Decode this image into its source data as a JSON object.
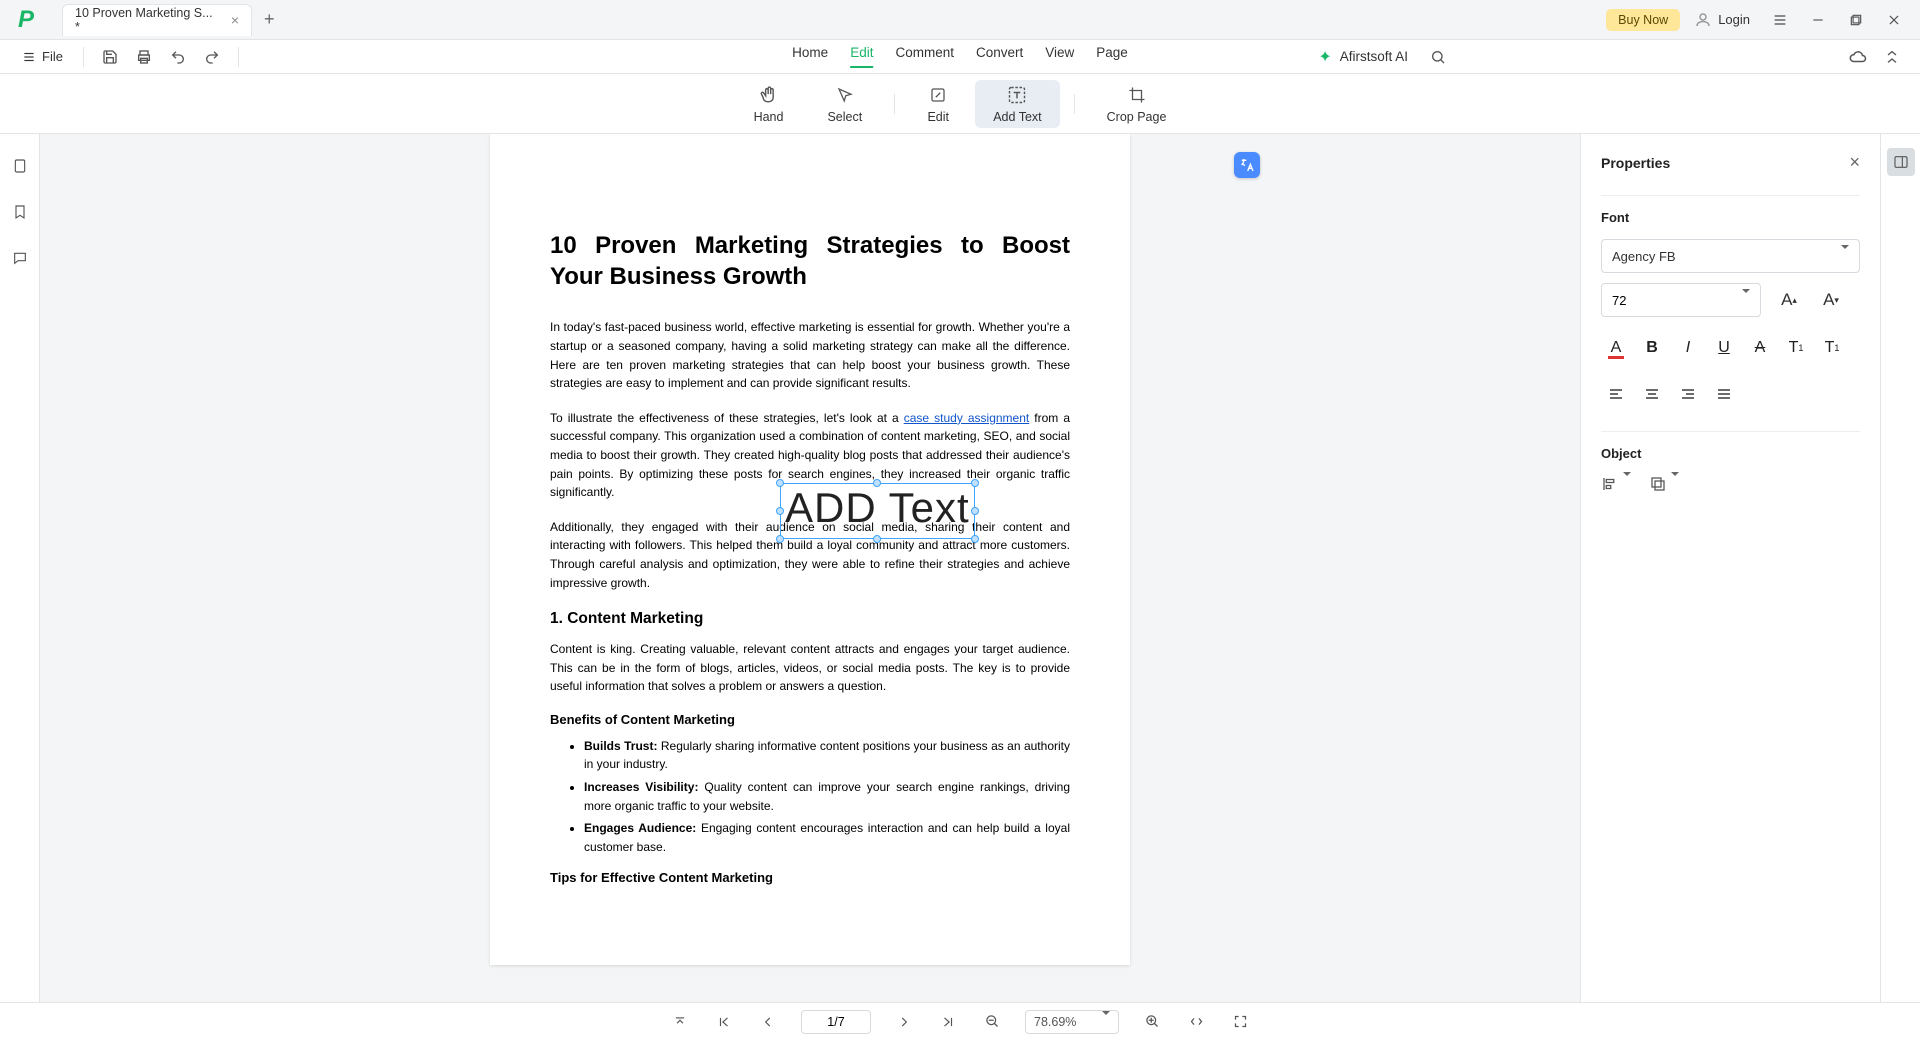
{
  "titlebar": {
    "tab_title": "10 Proven Marketing S... *",
    "buy_now": "Buy Now",
    "login": "Login"
  },
  "filerow": {
    "file_label": "File"
  },
  "menu_tabs": {
    "home": "Home",
    "edit": "Edit",
    "comment": "Comment",
    "convert": "Convert",
    "view": "View",
    "page": "Page"
  },
  "ai": {
    "label": "Afirstsoft AI"
  },
  "tools": {
    "hand": "Hand",
    "select": "Select",
    "edit": "Edit",
    "add_text": "Add Text",
    "crop_page": "Crop Page"
  },
  "document": {
    "title": "10 Proven Marketing Strategies to Boost Your Business Growth",
    "p1": "In today's fast-paced business world, effective marketing is essential for growth. Whether you're a startup or a seasoned company, having a solid marketing strategy can make all the difference. Here are ten proven marketing strategies that can help boost your business growth. These strategies are easy to implement and can provide significant results.",
    "p2a": "To illustrate the effectiveness of these strategies, let's look at a ",
    "p2link": "case study assignment",
    "p2b": " from a successful company. This organization used a combination of content marketing, SEO, and social media to boost their growth. They created high-quality blog posts that addressed their audience's pain points. By optimizing these posts for search engines, they increased their organic traffic significantly.",
    "p3": "Additionally, they engaged with their audience on social media, sharing their content and interacting with followers. This helped them build a loyal community and attract more customers. Through careful analysis and optimization, they were able to refine their strategies and achieve impressive growth.",
    "h2_1": "1. Content Marketing",
    "p4": "Content is king. Creating valuable, relevant content attracts and engages your target audience. This can be in the form of blogs, articles, videos, or social media posts. The key is to provide useful information that solves a problem or answers a question.",
    "h3_benefits": "Benefits of Content Marketing",
    "li1_b": "Builds Trust:",
    "li1": " Regularly sharing informative content positions your business as an authority in your industry.",
    "li2_b": "Increases Visibility:",
    "li2": " Quality content can improve your search engine rankings, driving more organic traffic to your website.",
    "li3_b": "Engages Audience:",
    "li3": " Engaging content encourages interaction and can help build a loyal customer base.",
    "h3_tips": "Tips for Effective Content Marketing",
    "added_text": "ADD Text"
  },
  "properties": {
    "title": "Properties",
    "font_section": "Font",
    "font_family": "Agency FB",
    "font_size": "72",
    "object_section": "Object"
  },
  "bottombar": {
    "page_indicator": "1/7",
    "zoom": "78.69%"
  }
}
